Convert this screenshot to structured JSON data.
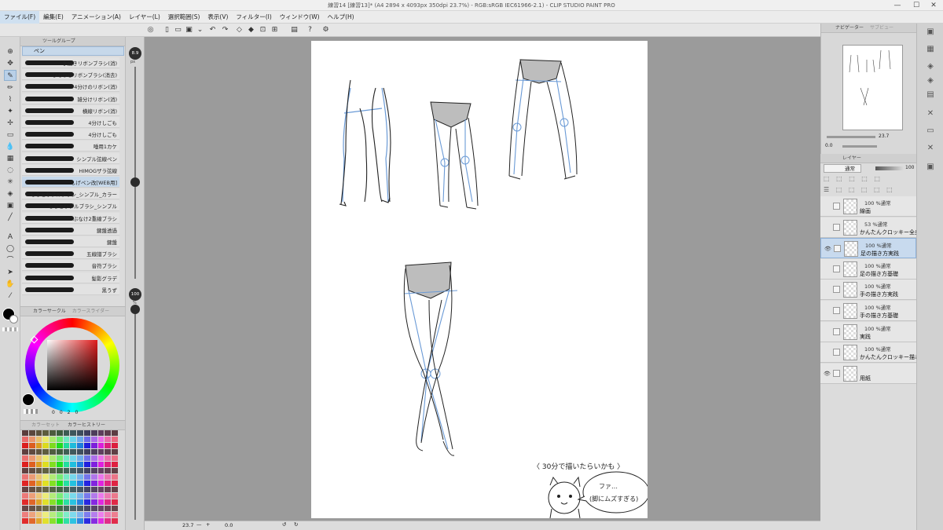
{
  "window": {
    "title": "練習14 [練習13]* (A4 2894 x 4093px 350dpi 23.7%) - RGB:sRGB IEC61966-2.1) - CLIP STUDIO PAINT PRO",
    "controls": {
      "minimize": "—",
      "maximize": "☐",
      "close": "✕"
    }
  },
  "menu": [
    "ファイル(F)",
    "編集(E)",
    "アニメーション(A)",
    "レイヤー(L)",
    "選択範囲(S)",
    "表示(V)",
    "フィルター(I)",
    "ウィンドウ(W)",
    "ヘルプ(H)"
  ],
  "tool_panel": {
    "group_tab": "ツールグループ",
    "sub_tool_header": "ペン",
    "brushes": [
      "手描きリボンブラシ(消)",
      "ひもつきリボンブラシ(消去)",
      "4分けのリボン(消)",
      "雑分けリボン(消)",
      "横線リボン(消)",
      "4分けしごも",
      "4分けしごも",
      "唾用1カケ",
      "シンプル弦線ペン",
      "HIMOGザラ弦線",
      "しげペン改[WEB用]",
      "しろとりブルブラシ_シンプル_カラー",
      "しろとりブルブラシ_シンプル",
      "ぶなけ2重線ブラシ",
      "鍵盤透過",
      "鍵盤",
      "五線譜ブラシ",
      "音符ブラシ",
      "髪影グラデ",
      "黒うず"
    ],
    "selected_brush_index": 10
  },
  "brush_size": {
    "size_label": "8.9",
    "size_unit": "px",
    "opacity_label": "100",
    "opacity_unit": "%"
  },
  "color_panel": {
    "tabs": [
      "カラーサークル",
      "カラースライダー"
    ],
    "values": [
      "0",
      "0",
      "2",
      "0"
    ],
    "main_color": "#000000"
  },
  "palette_panel": {
    "tabs": [
      "カラーセット",
      "カラーヒストリー"
    ]
  },
  "canvas": {
    "zoom": "23.7",
    "rotation": "0.0",
    "annotation_text": "〈 30分で描いたらいかも 〉",
    "speech_line1": "ファ…",
    "speech_line2": "(脚にムズすぎる)"
  },
  "navigator": {
    "tabs": [
      "ナビゲーター",
      "サブビュー"
    ],
    "zoom": "23.7",
    "rotation": "0.0"
  },
  "layer_panel": {
    "tab": "レイヤー",
    "blend_mode": "通常",
    "opacity": "100",
    "layers": [
      {
        "blend": "100 %通常",
        "name": "線画",
        "visible": false,
        "selected": false
      },
      {
        "blend": "53 %通常",
        "name": "かんたんクロッキー全身",
        "visible": false,
        "selected": false
      },
      {
        "blend": "100 %通常",
        "name": "足の描き方実践",
        "visible": true,
        "selected": true
      },
      {
        "blend": "100 %通常",
        "name": "足の描き方基礎",
        "visible": false,
        "selected": false
      },
      {
        "blend": "100 %通常",
        "name": "手の描き方実践",
        "visible": false,
        "selected": false
      },
      {
        "blend": "100 %通常",
        "name": "手の描き方基礎",
        "visible": false,
        "selected": false
      },
      {
        "blend": "100 %通常",
        "name": "実践",
        "visible": false,
        "selected": false
      },
      {
        "blend": "100 %通常",
        "name": "かんたんクロッキー描き方",
        "visible": false,
        "selected": false
      },
      {
        "blend": "",
        "name": "用紙",
        "visible": true,
        "selected": false
      }
    ]
  },
  "colors": {
    "accent": "#c8daee",
    "sketch_blue": "#6a9ad6",
    "line_dark": "#222222"
  }
}
